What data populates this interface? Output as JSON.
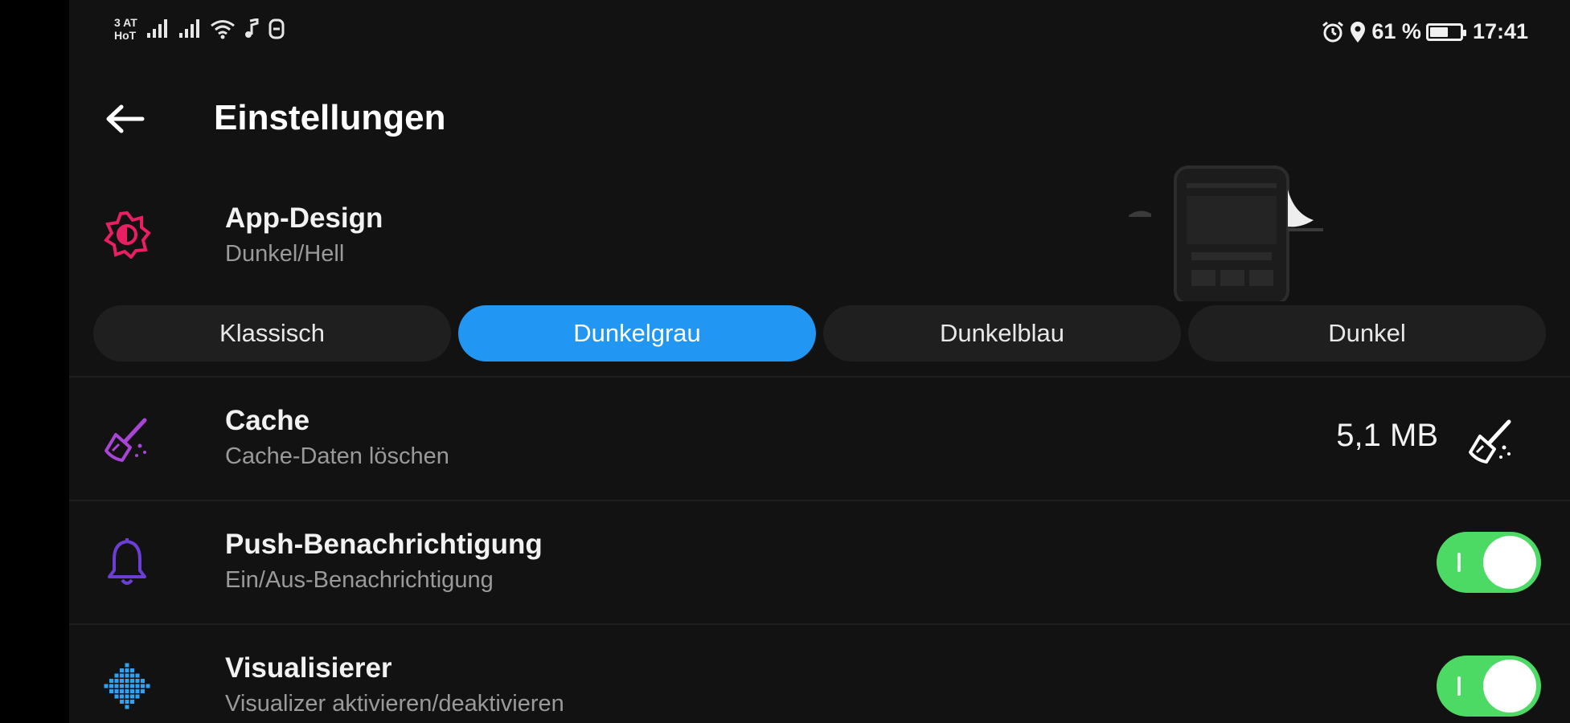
{
  "status_bar": {
    "carrier_top": "3 AT",
    "carrier_bottom": "HoT",
    "battery_percent": "61 %",
    "battery_level": 0.61,
    "time": "17:41",
    "icons": [
      "signal-icon",
      "signal-icon",
      "wifi-icon",
      "music-note-icon",
      "storage-icon",
      "alarm-icon",
      "location-icon",
      "battery-icon"
    ]
  },
  "header": {
    "title": "Einstellungen",
    "back_icon": "arrow-left-icon"
  },
  "settings": {
    "app_design": {
      "title": "App-Design",
      "subtitle": "Dunkel/Hell",
      "icon": "theme-sun-icon",
      "icon_color": "#e91e63",
      "themes": [
        "Klassisch",
        "Dunkelgrau",
        "Dunkelblau",
        "Dunkel"
      ],
      "selected_theme": "Dunkelgrau"
    },
    "cache": {
      "title": "Cache",
      "subtitle": "Cache-Daten löschen",
      "size": "5,1 MB",
      "icon": "broom-icon",
      "icon_color": "#a845d6"
    },
    "push": {
      "title": "Push-Benachrichtigung",
      "subtitle": "Ein/Aus-Benachrichtigung",
      "enabled": true,
      "icon": "bell-icon",
      "icon_color": "#6b3fd6"
    },
    "visualizer": {
      "title": "Visualisierer",
      "subtitle": "Visualizer aktivieren/deaktivieren",
      "enabled": true,
      "icon": "visualizer-icon",
      "icon_color": "#2ea3f2"
    }
  },
  "colors": {
    "background": "#121212",
    "accent": "#2196f3",
    "toggle_on": "#4cd964"
  }
}
